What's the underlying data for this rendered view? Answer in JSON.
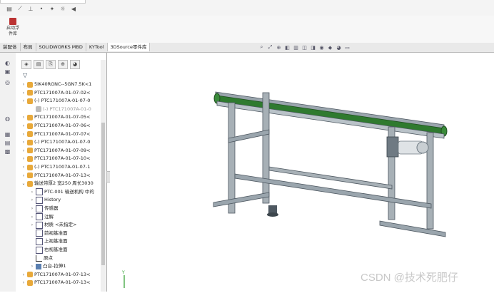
{
  "ribbon": {
    "launch_label_line1": "启动浮",
    "launch_label_line2": "件库"
  },
  "tabs": [
    {
      "label": "装配体"
    },
    {
      "label": "布局"
    },
    {
      "label": "SOLIDWORKS MBD"
    },
    {
      "label": "KYTool"
    },
    {
      "label": "3DSource零件库",
      "active": true
    }
  ],
  "tree": {
    "rows": [
      {
        "label": "5IK40RGNC--5GN7.5K<1",
        "type": "part"
      },
      {
        "label": "PTC171007A-01-07-02<",
        "type": "part"
      },
      {
        "label": "(-) PTC171007A-01-07-0",
        "type": "part"
      },
      {
        "label": "(-) PTC171007A-01-0",
        "type": "grey"
      },
      {
        "label": "PTC171007A-01-07-05<",
        "type": "part"
      },
      {
        "label": "PTC171007A-01-07-06<",
        "type": "part"
      },
      {
        "label": "PTC171007A-01-07-07<",
        "type": "part"
      },
      {
        "label": "(-) PTC171007A-01-07-0",
        "type": "part"
      },
      {
        "label": "PTC171007A-01-07-09<",
        "type": "part"
      },
      {
        "label": "PTC171007A-01-07-10<",
        "type": "part"
      },
      {
        "label": "(-) PTC171007A-01-07-1",
        "type": "part"
      },
      {
        "label": "PTC171007A-01-07-13<",
        "type": "part"
      },
      {
        "label": "输送带厚2 宽250 周长3030",
        "type": "part"
      },
      {
        "label": "PTC-001 输送机构 中的",
        "type": "doc"
      },
      {
        "label": "History",
        "type": "doc"
      },
      {
        "label": "传感器",
        "type": "doc"
      },
      {
        "label": "注解",
        "type": "doc"
      },
      {
        "label": "材质 <未指定>",
        "type": "doc"
      },
      {
        "label": "前视基准面",
        "type": "plane"
      },
      {
        "label": "上视基准面",
        "type": "plane"
      },
      {
        "label": "右视基准面",
        "type": "plane"
      },
      {
        "label": "原点",
        "type": "origin"
      },
      {
        "label": "凸台-拉伸1",
        "type": "blue"
      },
      {
        "label": "PTC171007A-01-07-13<",
        "type": "part"
      },
      {
        "label": "PTC171007A-01-07-13<",
        "type": "part"
      }
    ]
  },
  "watermark": "CSDN @技术死肥仔",
  "colors": {
    "belt": "#2f7a2f",
    "frame": "#8f9aa3",
    "frame_dark": "#4e5861"
  }
}
